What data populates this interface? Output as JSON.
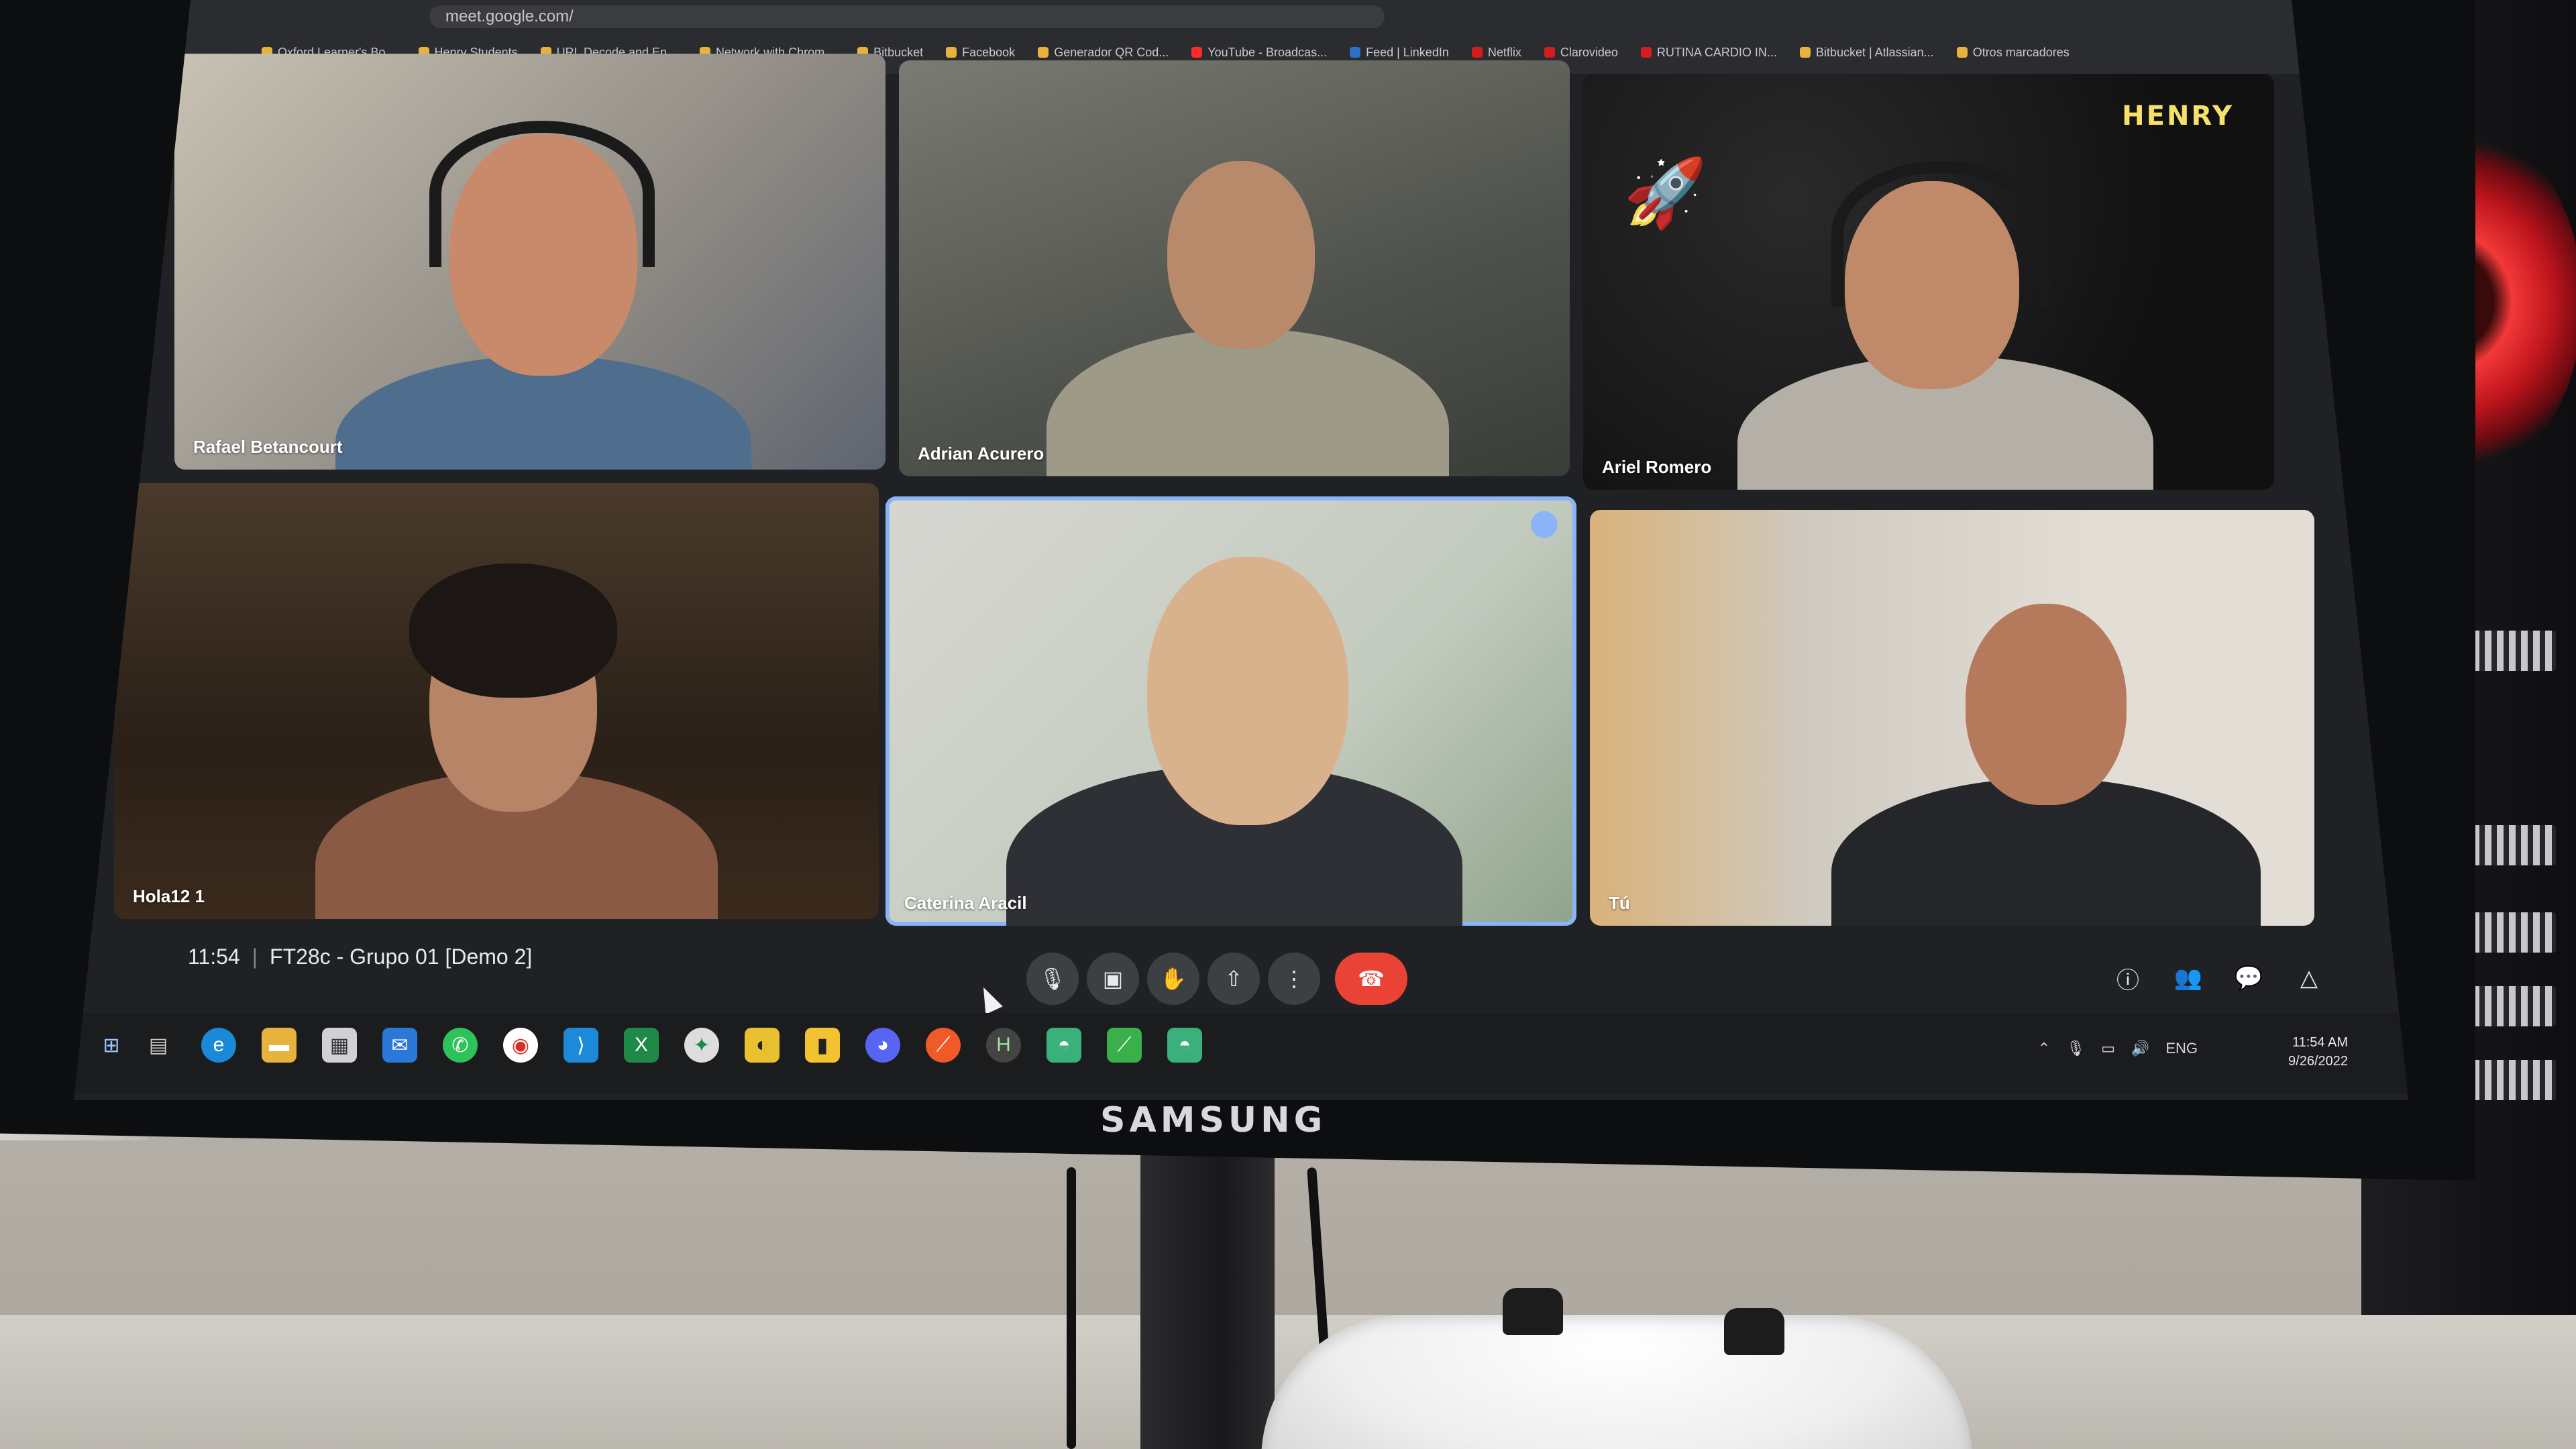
{
  "browser": {
    "url": "meet.google.com/",
    "bookmarks": [
      "Oxford Learner's Bo...",
      "Henry Students",
      "URL Decode and En...",
      "Network with Chrom...",
      "Bitbucket",
      "Facebook",
      "Generador QR Cod...",
      "YouTube - Broadcas...",
      "Feed | LinkedIn",
      "Netflix",
      "Clarovideo",
      "RUTINA CARDIO IN...",
      "Bitbucket | Atlassian...",
      "Otros marcadores"
    ]
  },
  "meeting": {
    "clock": "11:54",
    "title": "FT28c - Grupo 01 [Demo 2]",
    "brand_logo": "HENRY",
    "participants": [
      {
        "name": "Rafael Betancourt"
      },
      {
        "name": "Adrian Acurero"
      },
      {
        "name": "Ariel Romero"
      },
      {
        "name": "Hola12 1"
      },
      {
        "name": "Caterina Aracil"
      },
      {
        "name": "Tú"
      }
    ]
  },
  "controls": {
    "mic_icon": "mic-icon",
    "camera_icon": "camera-icon",
    "hand_icon": "raise-hand-icon",
    "present_icon": "present-icon",
    "more_icon": "more-icon",
    "end_icon": "end-call-icon",
    "info_icon": "info-icon",
    "people_icon": "people-icon",
    "chat_icon": "chat-icon",
    "activities_icon": "activities-icon"
  },
  "tray": {
    "language": "ENG",
    "time": "11:54 AM",
    "date": "9/26/2022"
  },
  "monitor": {
    "brand": "SAMSUNG"
  },
  "colors": {
    "meet_bg": "#202124",
    "end_call": "#ea4335",
    "active_speaker": "#8ab4f8",
    "fan_glow": "#ff3a3a"
  }
}
